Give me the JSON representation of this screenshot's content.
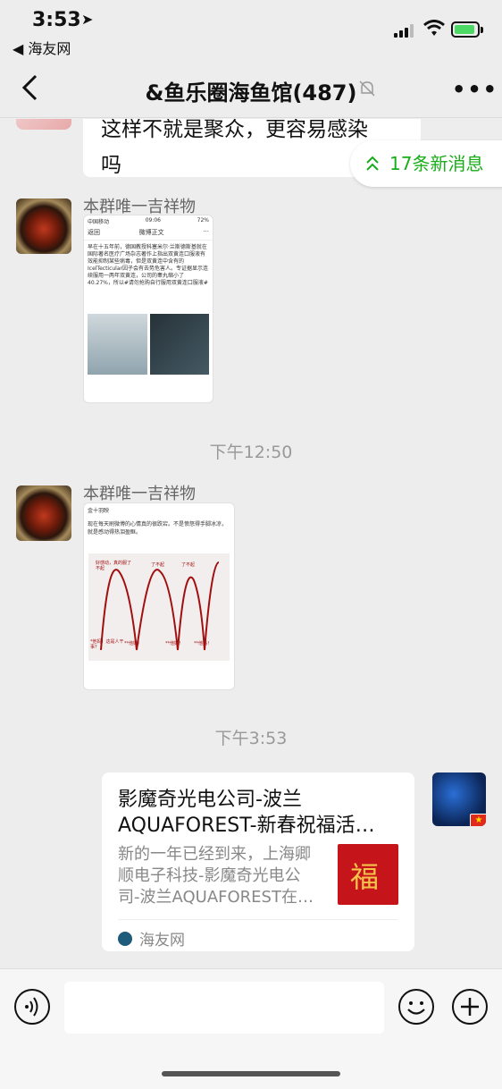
{
  "status": {
    "time": "3:53",
    "back_app": "◀ 海友网"
  },
  "nav": {
    "title": "&鱼乐圈海鱼馆(487)"
  },
  "messages": {
    "top_bubble": {
      "line1": "这样不就是聚众，更容易感染",
      "line2": "吗"
    },
    "new_messages": "17条新消息",
    "msg1": {
      "sender": "本群唯一吉祥物",
      "img": {
        "status_left": "中国移动",
        "status_time": "09:06",
        "status_right": "72%",
        "back": "返回",
        "title": "微博正文",
        "body": "早在十五年前，德国教授科塞米尔·兰斯德斯基就在国际著名医疗广场杂志著作上指出双黄连口服液有效能抑制某些病毒，但是双黄连中含有的IcelTecticular因子会有去势危害人。专证据显示连续服用一两年双黄连，公司的睾丸缩小了40.27%，所以#请勿抢购自行服用双黄连口服液#"
      }
    },
    "time1": "下午12:50",
    "msg2": {
      "sender": "本群唯一吉祥物",
      "img": {
        "user": "金十羽映",
        "text": "现在每天刷微博的心情真的很跌宕。不是愤怒得手脚冰凉，就是感动得热泪盈眶。",
        "labels": [
          "好感动，真的服了不起",
          "了不起",
          "了不起",
          "*他妈！这是人干事？",
          "**他妈！",
          "**他妈！",
          "**他妈！"
        ]
      }
    },
    "time2": "下午3:53",
    "card": {
      "title_line1": "影魔奇光电公司-波兰",
      "title_line2": "AQUAFOREST-新春祝福活…",
      "desc": "新的一年已经到来，上海卿顺电子科技-影魔奇光电公司-波兰AQUAFOREST在…",
      "thumb_char": "福",
      "source": "海友网"
    }
  },
  "input": {
    "placeholder": ""
  }
}
